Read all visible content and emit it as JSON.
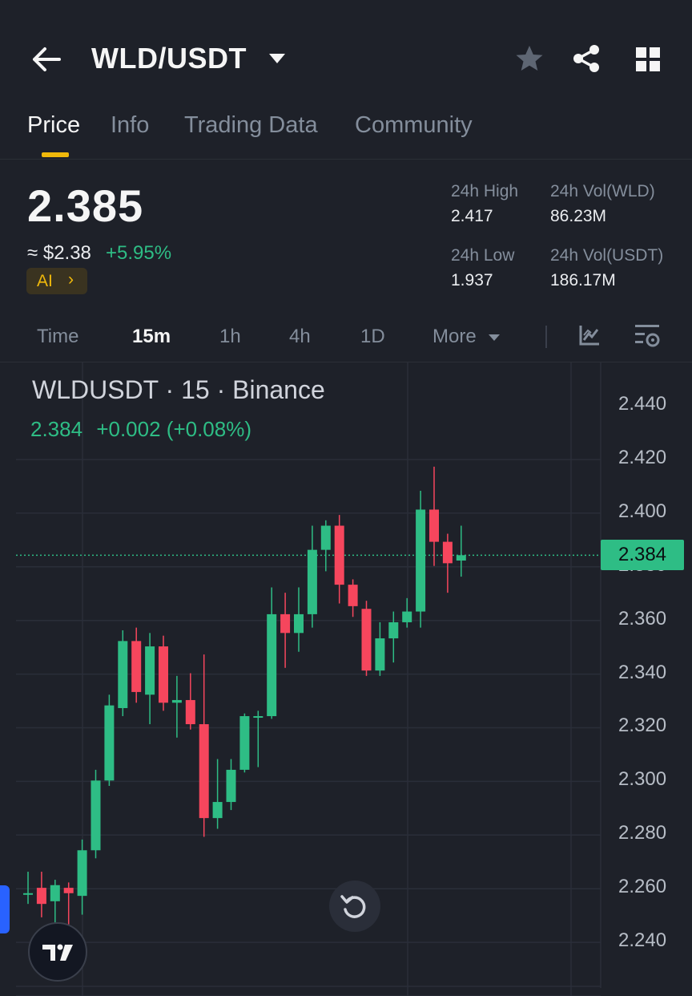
{
  "header": {
    "title": "WLD/USDT"
  },
  "tabs": [
    "Price",
    "Info",
    "Trading Data",
    "Community"
  ],
  "ticker": {
    "price": "2.385",
    "fiat": "≈ $2.38",
    "change": "+5.95%",
    "ai_label": "AI",
    "high_label": "24h High",
    "high": "2.417",
    "low_label": "24h Low",
    "low": "1.937",
    "vol_base_label": "24h Vol(WLD)",
    "vol_base": "86.23M",
    "vol_quote_label": "24h Vol(USDT)",
    "vol_quote": "186.17M"
  },
  "intervals": [
    "Time",
    "15m",
    "1h",
    "4h",
    "1D"
  ],
  "more_label": "More",
  "chart": {
    "legend_symbol": "WLDUSDT · 15 · Binance",
    "legend_close": "2.384",
    "legend_change": "+0.002 (+0.08%)",
    "current_price_label": "2.384"
  },
  "colors": {
    "up": "#2ebd85",
    "down": "#f6465d",
    "accent": "#f0b90b",
    "bg": "#1e2129"
  },
  "chart_data": {
    "type": "candlestick",
    "ylim": [
      2.225,
      2.45
    ],
    "yticks": [
      "2.440",
      "2.420",
      "2.400",
      "2.380",
      "2.360",
      "2.340",
      "2.320",
      "2.300",
      "2.280",
      "2.260",
      "2.240"
    ],
    "current_price": 2.384,
    "candles": [
      {
        "o": 2.258,
        "h": 2.266,
        "l": 2.254,
        "c": 2.258
      },
      {
        "o": 2.26,
        "h": 2.266,
        "l": 2.249,
        "c": 2.254
      },
      {
        "o": 2.255,
        "h": 2.263,
        "l": 2.246,
        "c": 2.261
      },
      {
        "o": 2.26,
        "h": 2.262,
        "l": 2.246,
        "c": 2.258
      },
      {
        "o": 2.257,
        "h": 2.278,
        "l": 2.25,
        "c": 2.274
      },
      {
        "o": 2.274,
        "h": 2.304,
        "l": 2.271,
        "c": 2.3
      },
      {
        "o": 2.3,
        "h": 2.332,
        "l": 2.298,
        "c": 2.328
      },
      {
        "o": 2.327,
        "h": 2.356,
        "l": 2.324,
        "c": 2.352
      },
      {
        "o": 2.352,
        "h": 2.357,
        "l": 2.329,
        "c": 2.333
      },
      {
        "o": 2.332,
        "h": 2.355,
        "l": 2.321,
        "c": 2.35
      },
      {
        "o": 2.35,
        "h": 2.354,
        "l": 2.326,
        "c": 2.329
      },
      {
        "o": 2.329,
        "h": 2.339,
        "l": 2.316,
        "c": 2.33
      },
      {
        "o": 2.33,
        "h": 2.34,
        "l": 2.319,
        "c": 2.321
      },
      {
        "o": 2.321,
        "h": 2.347,
        "l": 2.279,
        "c": 2.286
      },
      {
        "o": 2.286,
        "h": 2.308,
        "l": 2.282,
        "c": 2.292
      },
      {
        "o": 2.292,
        "h": 2.308,
        "l": 2.289,
        "c": 2.304
      },
      {
        "o": 2.304,
        "h": 2.325,
        "l": 2.303,
        "c": 2.324
      },
      {
        "o": 2.324,
        "h": 2.326,
        "l": 2.305,
        "c": 2.324
      },
      {
        "o": 2.324,
        "h": 2.372,
        "l": 2.323,
        "c": 2.362
      },
      {
        "o": 2.362,
        "h": 2.37,
        "l": 2.342,
        "c": 2.355
      },
      {
        "o": 2.355,
        "h": 2.372,
        "l": 2.348,
        "c": 2.362
      },
      {
        "o": 2.362,
        "h": 2.395,
        "l": 2.357,
        "c": 2.386
      },
      {
        "o": 2.386,
        "h": 2.397,
        "l": 2.378,
        "c": 2.395
      },
      {
        "o": 2.395,
        "h": 2.399,
        "l": 2.366,
        "c": 2.373
      },
      {
        "o": 2.373,
        "h": 2.375,
        "l": 2.361,
        "c": 2.365
      },
      {
        "o": 2.364,
        "h": 2.367,
        "l": 2.339,
        "c": 2.341
      },
      {
        "o": 2.341,
        "h": 2.359,
        "l": 2.339,
        "c": 2.353
      },
      {
        "o": 2.353,
        "h": 2.363,
        "l": 2.344,
        "c": 2.359
      },
      {
        "o": 2.359,
        "h": 2.368,
        "l": 2.357,
        "c": 2.363
      },
      {
        "o": 2.363,
        "h": 2.408,
        "l": 2.357,
        "c": 2.401
      },
      {
        "o": 2.401,
        "h": 2.417,
        "l": 2.38,
        "c": 2.389
      },
      {
        "o": 2.389,
        "h": 2.392,
        "l": 2.37,
        "c": 2.381
      },
      {
        "o": 2.382,
        "h": 2.395,
        "l": 2.376,
        "c": 2.384
      }
    ]
  }
}
